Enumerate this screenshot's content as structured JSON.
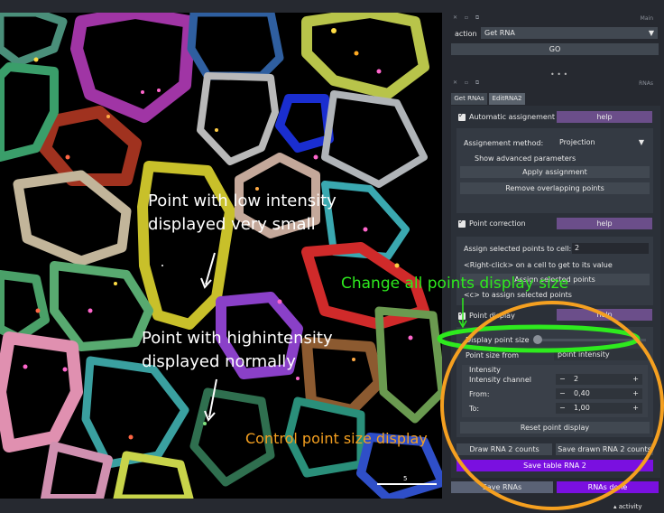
{
  "annotations": {
    "low_intensity_line1": "Point with low intensity",
    "low_intensity_line2": "displayed very small",
    "high_intensity_line1": "Point with highintensity",
    "high_intensity_line2": "displayed normally",
    "change_all": "Change all points display size",
    "control": "Control point size display"
  },
  "scale_bar_label": "5",
  "main_dock": {
    "title": "Main",
    "action_label": "action",
    "action_value": "Get RNA",
    "go_label": "GO"
  },
  "rnas_dock": {
    "title": "RNAs",
    "tabs": [
      "Get RNAs",
      "EditRNA2"
    ],
    "auto_assign_label": "Automatic assignement",
    "help_label": "help",
    "assign_method_label": "Assignement method:",
    "assign_method_value": "Projection",
    "show_advanced_label": "Show advanced parameters",
    "apply_assignment_label": "Apply assignment",
    "remove_overlap_label": "Remove overlapping points",
    "point_correction_label": "Point correction",
    "assign_selected_label": "Assign selected points to cell:",
    "assign_selected_value": "2",
    "right_click_hint": "<Right-click> on a cell to get to its value",
    "assign_selected_button": "Assign selected points",
    "c_hint": "<c> to assign selected points",
    "point_display_label": "Point display",
    "display_size_label": "Display point size",
    "point_size_from_label": "Point size from",
    "point_size_from_value": "point intensity",
    "intensity_title": "Intensity",
    "intensity_channel_label": "Intensity channel",
    "intensity_channel_value": "2",
    "from_label": "From:",
    "from_value": "0,40",
    "to_label": "To:",
    "to_value": "1,00",
    "reset_label": "Reset point display",
    "draw_counts_label": "Draw RNA 2 counts",
    "save_drawn_label": "Save drawn RNA 2 counts",
    "save_table_label": "Save table RNA 2",
    "save_rnas_label": "Save RNAs",
    "rnas_done_label": "RNAs done"
  },
  "activity_label": "activity",
  "colors": {
    "panel_bg": "#262930",
    "help_purple": "#6b4e8a",
    "save_violet": "#7a10e0",
    "annotation_green": "#2eea1e",
    "annotation_orange": "#f5a020"
  }
}
